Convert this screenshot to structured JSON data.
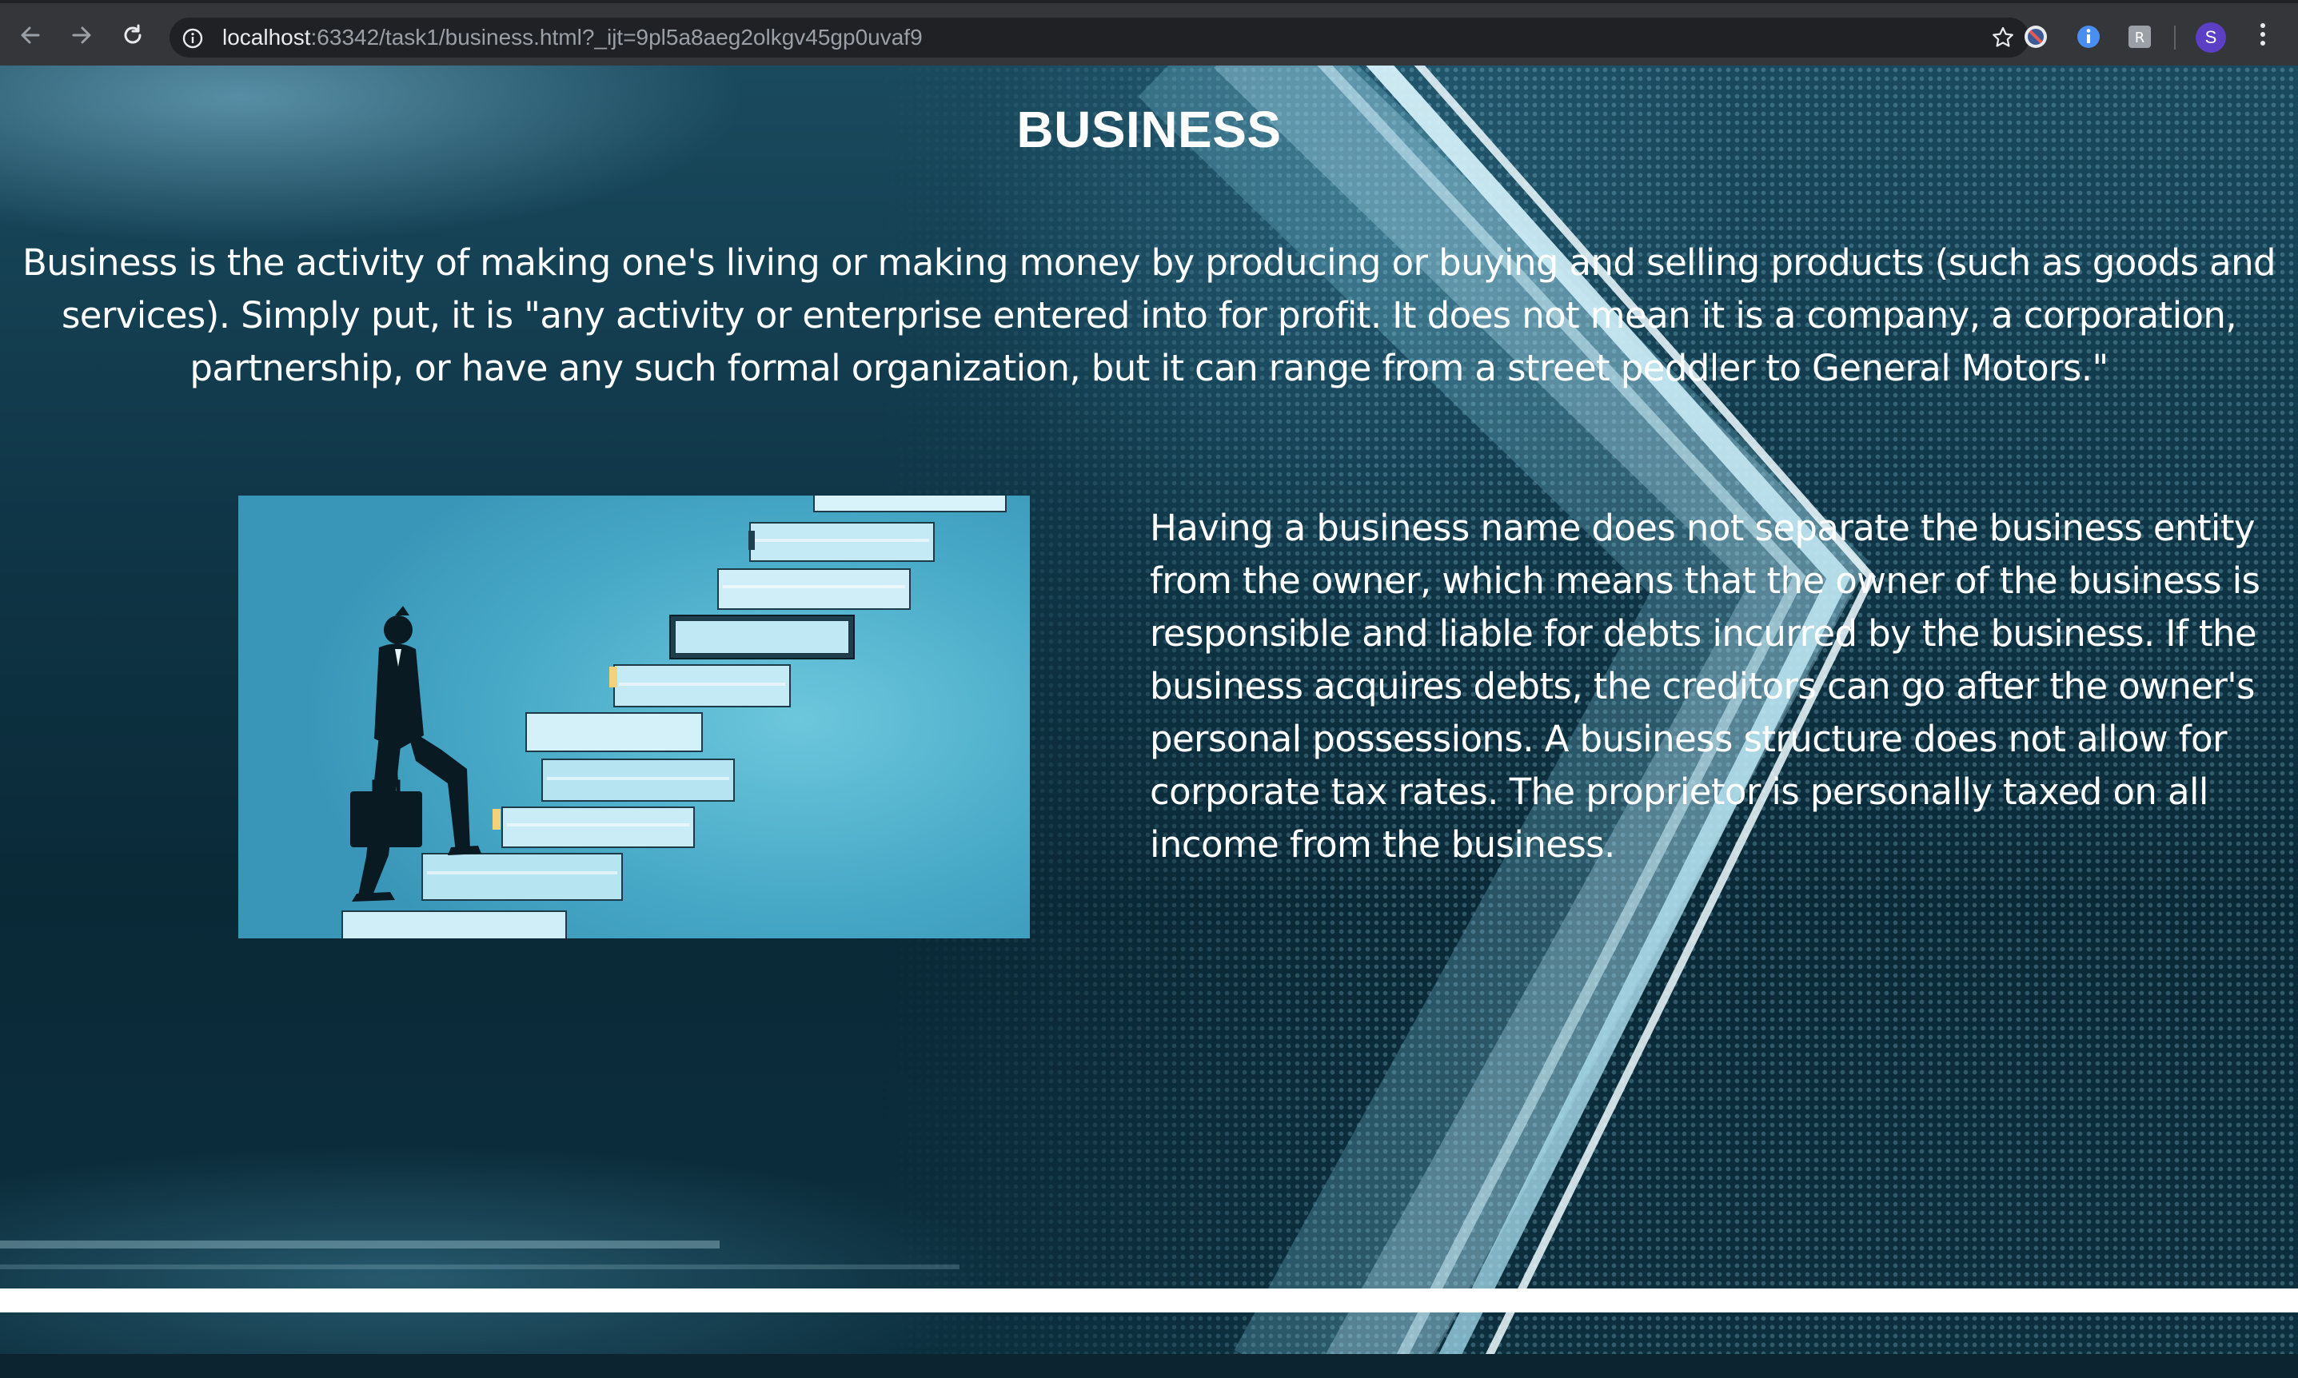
{
  "browser": {
    "url_host": "localhost",
    "url_path": ":63342/task1/business.html?_ijt=9pl5a8aeg2olkgv45gp0uvaf9",
    "profile_initial": "S",
    "icons": [
      "back-arrow-icon",
      "forward-arrow-icon",
      "reload-icon",
      "info-icon",
      "bookmark-star-icon",
      "blocker-extension-icon",
      "info-extension-icon",
      "translate-extension-icon",
      "kebab-menu-icon"
    ]
  },
  "page": {
    "title": "BUSINESS",
    "intro": "Business is the activity of making one's living or making money by producing or buying and selling products (such as goods and services). Simply put, it is \"any activity or enterprise entered into for profit. It does not mean it is a company, a corporation, partnership, or have any such formal organization, but it can range from a street peddler to General Motors.\"",
    "detail": "Having a business name does not separate the business entity from the owner, which means that the owner of the business is responsible and liable for debts incurred by the business. If the business acquires debts, the creditors can go after the owner's personal possessions. A business structure does not allow for corporate tax rates. The proprietor is personally taxed on all income from the business.",
    "illustration": "businessman-climbing-book-stairs",
    "colors": {
      "text": "#ffffff",
      "background_dark": "#0b2430",
      "illustration_blue": "#48a9c7"
    }
  }
}
